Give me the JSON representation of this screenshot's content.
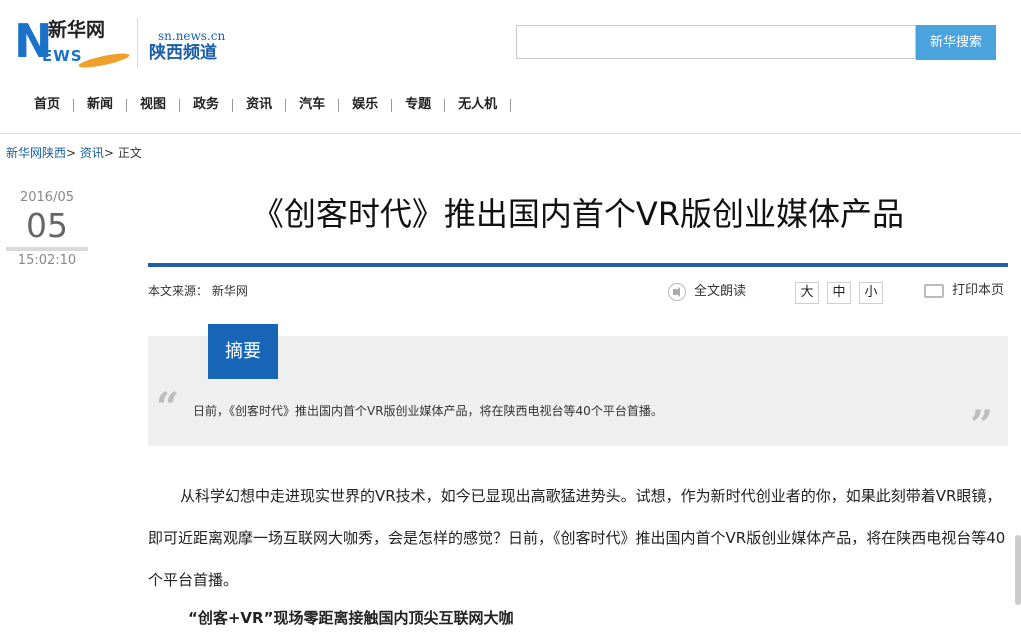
{
  "header": {
    "logo_cn": "新华网",
    "logo_n": "N",
    "logo_ews": "EWS",
    "channel_url": "sn.news.cn",
    "channel_name": "陕西频道",
    "search_button": "新华搜索"
  },
  "nav": [
    "首页",
    "新闻",
    "视图",
    "政务",
    "资讯",
    "汽车",
    "娱乐",
    "专题",
    "无人机"
  ],
  "breadcrumb": {
    "home": "新华网陕西",
    "section": "资讯",
    "current": "正文",
    "sep": ">"
  },
  "date": {
    "year_month": "2016/05",
    "day": "05",
    "time": "15:02:10"
  },
  "article": {
    "title": "《创客时代》推出国内首个VR版创业媒体产品",
    "source": "本文来源： 新华网",
    "read_aloud": "全文朗读",
    "font_sizes": [
      "大",
      "中",
      "小"
    ],
    "print": "打印本页",
    "summary_label": "摘要",
    "summary": "日前，《创客时代》推出国内首个VR版创业媒体产品，将在陕西电视台等40个平台首播。",
    "paragraph": "从科学幻想中走进现实世界的VR技术，如今已显现出高歌猛进势头。试想，作为新时代创业者的你，如果此刻带着VR眼镜，即可近距离观摩一场互联网大咖秀，会是怎样的感觉？日前，《创客时代》推出国内首个VR版创业媒体产品，将在陕西电视台等40个平台首播。",
    "subheading": "“创客+VR”现场零距离接触国内顶尖互联网大咖"
  },
  "colors": {
    "brand_blue": "#1a5fa8",
    "rule_blue": "#1f5fa6",
    "search_button": "#4aa3dc",
    "summary_tag": "#1665b6"
  }
}
